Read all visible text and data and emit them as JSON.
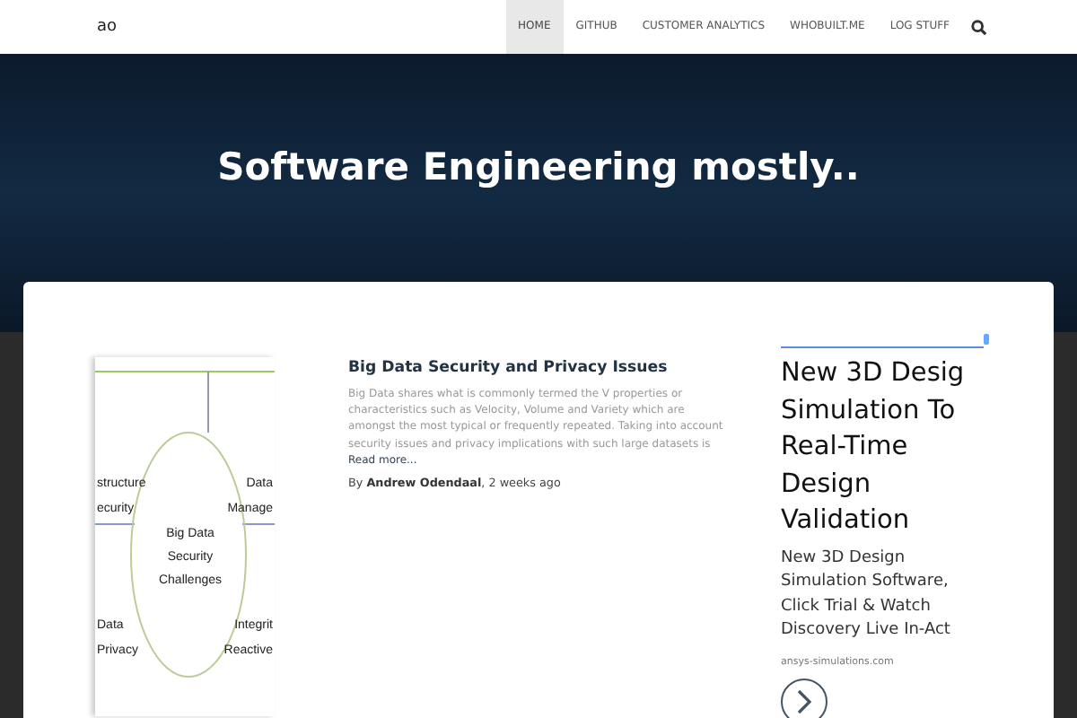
{
  "navbar": {
    "brand": "ao",
    "items": [
      {
        "label": "HOME",
        "selected": true
      },
      {
        "label": "GITHUB",
        "selected": false
      },
      {
        "label": "CUSTOMER ANALYTICS",
        "selected": false
      },
      {
        "label": "WHOBUILT.ME",
        "selected": false
      },
      {
        "label": "LOG STUFF",
        "selected": false
      }
    ]
  },
  "hero": {
    "title": "Software Engineering mostly.."
  },
  "post": {
    "diagram": {
      "center": "Big Data Security Challenges",
      "corners": [
        [
          "structure",
          "ecurity"
        ],
        [
          "Data",
          "Manage"
        ],
        [
          "Data",
          "Privacy"
        ],
        [
          "Integrit",
          "Reactive"
        ]
      ]
    },
    "title": "Big Data Security and Privacy Issues",
    "excerpt": "Big Data shares what is commonly termed the V properties or characteristics such as Velocity, Volume and Variety which are amongst the most typical or frequently repeated. Taking into account security issues and privacy implications with such large datasets is",
    "read_more": "Read more...",
    "byline_prefix": "By",
    "author": "Andrew Odendaal",
    "time": ", 2 weeks ago"
  },
  "ad": {
    "headline": [
      "New 3D Desig",
      "Simulation To",
      "Real-Time",
      "Design",
      "Validation"
    ],
    "description": [
      "New 3D Design",
      "Simulation Software,",
      "Click Trial & Watch",
      "Discovery Live In-Act"
    ],
    "domain": "ansys-simulations.com"
  }
}
